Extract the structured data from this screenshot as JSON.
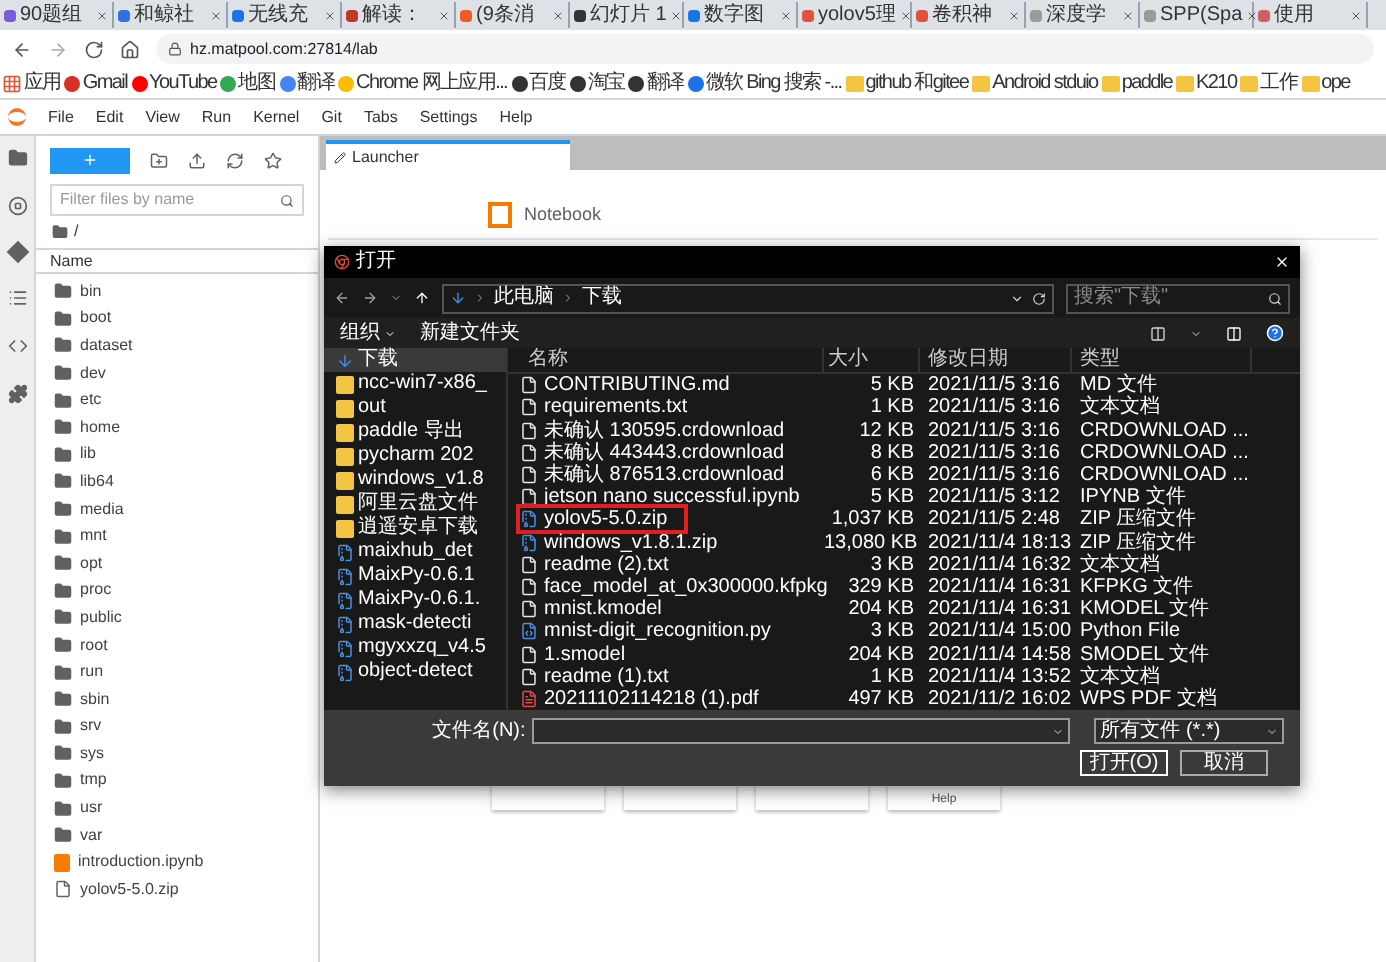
{
  "browser": {
    "tabs": [
      {
        "title": "90题组",
        "color": "#7b5cd6"
      },
      {
        "title": "和鲸社",
        "color": "#2f6fe0"
      },
      {
        "title": "无线充",
        "color": "#1a73e8"
      },
      {
        "title": "解读：",
        "color": "#c0392b"
      },
      {
        "title": "(9条消",
        "color": "#f05a28"
      },
      {
        "title": "幻灯片 1",
        "color": "#333333"
      },
      {
        "title": "数字图",
        "color": "#1a73e8"
      },
      {
        "title": "yolov5理",
        "color": "#e0533d"
      },
      {
        "title": "卷积神",
        "color": "#e0533d"
      },
      {
        "title": "深度学",
        "color": "#9a9a9a"
      },
      {
        "title": "SPP(Spa",
        "color": "#9a9a9a"
      },
      {
        "title": "使用",
        "color": "#d06060"
      }
    ],
    "address": "hz.matpool.com:27814/lab",
    "bookmarks": [
      {
        "label": "应用",
        "kind": "apps"
      },
      {
        "label": "Gmail",
        "kind": "site",
        "color": "#d93025"
      },
      {
        "label": "YouTube",
        "kind": "site",
        "color": "#ff0000"
      },
      {
        "label": "地图",
        "kind": "site",
        "color": "#34a853"
      },
      {
        "label": "翻译",
        "kind": "site",
        "color": "#4285f4"
      },
      {
        "label": "Chrome 网上应用...",
        "kind": "site",
        "color": "#fbbc04"
      },
      {
        "label": "百度",
        "kind": "site",
        "color": "#333333"
      },
      {
        "label": "淘宝",
        "kind": "site",
        "color": "#333333"
      },
      {
        "label": "翻译",
        "kind": "site",
        "color": "#333333"
      },
      {
        "label": "微软 Bing 搜索 -...",
        "kind": "site",
        "color": "#1a73e8"
      },
      {
        "label": "github 和gitee",
        "kind": "folder"
      },
      {
        "label": "Android stduio",
        "kind": "folder"
      },
      {
        "label": "paddle",
        "kind": "folder"
      },
      {
        "label": "K210",
        "kind": "folder"
      },
      {
        "label": "工作",
        "kind": "folder"
      },
      {
        "label": "ope",
        "kind": "folder"
      }
    ]
  },
  "menu": [
    "File",
    "Edit",
    "View",
    "Run",
    "Kernel",
    "Git",
    "Tabs",
    "Settings",
    "Help"
  ],
  "file_browser": {
    "filter_placeholder": "Filter files by name",
    "path": "/",
    "column": "Name",
    "items": [
      {
        "name": "bin",
        "kind": "folder"
      },
      {
        "name": "boot",
        "kind": "folder"
      },
      {
        "name": "dataset",
        "kind": "folder"
      },
      {
        "name": "dev",
        "kind": "folder"
      },
      {
        "name": "etc",
        "kind": "folder"
      },
      {
        "name": "home",
        "kind": "folder"
      },
      {
        "name": "lib",
        "kind": "folder"
      },
      {
        "name": "lib64",
        "kind": "folder"
      },
      {
        "name": "media",
        "kind": "folder"
      },
      {
        "name": "mnt",
        "kind": "folder"
      },
      {
        "name": "opt",
        "kind": "folder"
      },
      {
        "name": "proc",
        "kind": "folder"
      },
      {
        "name": "public",
        "kind": "folder"
      },
      {
        "name": "root",
        "kind": "folder"
      },
      {
        "name": "run",
        "kind": "folder"
      },
      {
        "name": "sbin",
        "kind": "folder"
      },
      {
        "name": "srv",
        "kind": "folder"
      },
      {
        "name": "sys",
        "kind": "folder"
      },
      {
        "name": "tmp",
        "kind": "folder"
      },
      {
        "name": "usr",
        "kind": "folder"
      },
      {
        "name": "var",
        "kind": "folder"
      },
      {
        "name": "introduction.ipynb",
        "kind": "notebook"
      },
      {
        "name": "yolov5-5.0.zip",
        "kind": "file"
      }
    ]
  },
  "launcher": {
    "tab": "Launcher",
    "section": "Notebook",
    "cards": [
      {
        "kind": "blank"
      },
      {
        "kind": "blank"
      },
      {
        "kind": "blank"
      },
      {
        "kind": "text",
        "label": "Help"
      }
    ]
  },
  "dialog": {
    "title": "打开",
    "path": [
      "此电脑",
      "下载"
    ],
    "search_placeholder": "搜索\"下载\"",
    "organize": "组织",
    "new_folder": "新建文件夹",
    "nav": [
      {
        "name": "下载",
        "kind": "download",
        "selected": true
      },
      {
        "name": "ncc-win7-x86_",
        "kind": "folder",
        "selected": false
      },
      {
        "name": "out",
        "kind": "folder",
        "selected": false
      },
      {
        "name": "paddle 导出",
        "kind": "folder",
        "selected": false
      },
      {
        "name": "pycharm 202",
        "kind": "folder",
        "selected": false
      },
      {
        "name": "windows_v1.8",
        "kind": "folder",
        "selected": false
      },
      {
        "name": "阿里云盘文件",
        "kind": "folder",
        "selected": false
      },
      {
        "name": "逍遥安卓下载",
        "kind": "folder",
        "selected": false
      },
      {
        "name": "maixhub_det",
        "kind": "zip",
        "selected": false
      },
      {
        "name": "MaixPy-0.6.1",
        "kind": "zip",
        "selected": false
      },
      {
        "name": "MaixPy-0.6.1.",
        "kind": "zip",
        "selected": false
      },
      {
        "name": "mask-detecti",
        "kind": "zip",
        "selected": false
      },
      {
        "name": "mgyxxzq_v4.5",
        "kind": "zip",
        "selected": false
      },
      {
        "name": "object-detect",
        "kind": "zip",
        "selected": false
      }
    ],
    "columns": [
      "名称",
      "大小",
      "修改日期",
      "类型"
    ],
    "rows": [
      {
        "name": "CONTRIBUTING.md",
        "size": "5 KB",
        "date": "2021/11/5 3:16",
        "type": "MD 文件",
        "kind": "doc",
        "marked": false
      },
      {
        "name": "requirements.txt",
        "size": "1 KB",
        "date": "2021/11/5 3:16",
        "type": "文本文档",
        "kind": "doc",
        "marked": false
      },
      {
        "name": "未确认 130595.crdownload",
        "size": "12 KB",
        "date": "2021/11/5 3:16",
        "type": "CRDOWNLOAD ...",
        "kind": "doc",
        "marked": false
      },
      {
        "name": "未确认 443443.crdownload",
        "size": "8 KB",
        "date": "2021/11/5 3:16",
        "type": "CRDOWNLOAD ...",
        "kind": "doc",
        "marked": false
      },
      {
        "name": "未确认 876513.crdownload",
        "size": "6 KB",
        "date": "2021/11/5 3:16",
        "type": "CRDOWNLOAD ...",
        "kind": "doc",
        "marked": false
      },
      {
        "name": "jetson nano successful.ipynb",
        "size": "5 KB",
        "date": "2021/11/5 3:12",
        "type": "IPYNB 文件",
        "kind": "doc",
        "marked": false
      },
      {
        "name": "yolov5-5.0.zip",
        "size": "1,037 KB",
        "date": "2021/11/5 2:48",
        "type": "ZIP 压缩文件",
        "kind": "zip",
        "marked": true
      },
      {
        "name": "windows_v1.8.1.zip",
        "size": "13,080 KB",
        "date": "2021/11/4 18:13",
        "type": "ZIP 压缩文件",
        "kind": "zip",
        "marked": false
      },
      {
        "name": "readme (2).txt",
        "size": "3 KB",
        "date": "2021/11/4 16:32",
        "type": "文本文档",
        "kind": "doc",
        "marked": false
      },
      {
        "name": "face_model_at_0x300000.kfpkg",
        "size": "329 KB",
        "date": "2021/11/4 16:31",
        "type": "KFPKG 文件",
        "kind": "doc",
        "marked": false
      },
      {
        "name": "mnist.kmodel",
        "size": "204 KB",
        "date": "2021/11/4 16:31",
        "type": "KMODEL 文件",
        "kind": "doc",
        "marked": false
      },
      {
        "name": "mnist-digit_recognition.py",
        "size": "3 KB",
        "date": "2021/11/4 15:00",
        "type": "Python File",
        "kind": "python",
        "marked": false
      },
      {
        "name": "1.smodel",
        "size": "204 KB",
        "date": "2021/11/4 14:58",
        "type": "SMODEL 文件",
        "kind": "doc",
        "marked": false
      },
      {
        "name": "readme (1).txt",
        "size": "1 KB",
        "date": "2021/11/4 13:52",
        "type": "文本文档",
        "kind": "doc",
        "marked": false
      },
      {
        "name": "20211102114218 (1).pdf",
        "size": "497 KB",
        "date": "2021/11/2 16:02",
        "type": "WPS PDF 文档",
        "kind": "pdf",
        "marked": false
      }
    ],
    "filename_label": "文件名(N):",
    "filter": "所有文件 (*.*)",
    "open_button": "打开(O)",
    "cancel_button": "取消"
  }
}
